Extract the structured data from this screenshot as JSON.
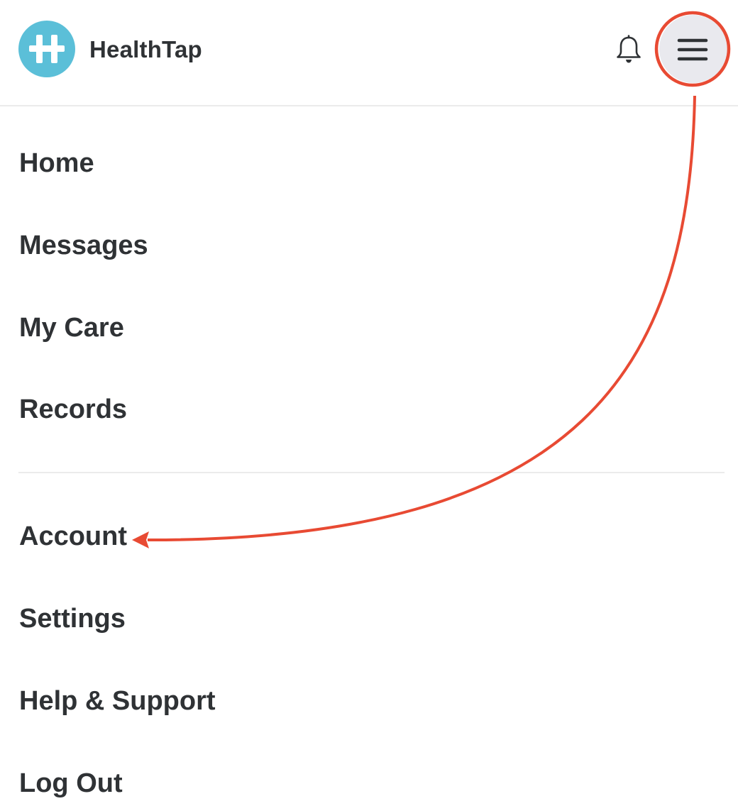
{
  "header": {
    "brand_name": "HealthTap",
    "logo_icon": "healthtap-logo-icon",
    "notifications_icon": "bell-icon",
    "menu_icon": "hamburger-menu-icon"
  },
  "menu": {
    "primary_items": [
      {
        "label": "Home"
      },
      {
        "label": "Messages"
      },
      {
        "label": "My Care"
      },
      {
        "label": "Records"
      }
    ],
    "secondary_items": [
      {
        "label": "Account"
      },
      {
        "label": "Settings"
      },
      {
        "label": "Help & Support"
      },
      {
        "label": "Log Out"
      }
    ]
  },
  "annotation": {
    "highlight_color": "#e84a33",
    "type": "arrow from menu button to Account item"
  },
  "colors": {
    "brand_teal": "#5bbfd8",
    "text": "#2f3235",
    "menu_button_bg": "#e9e9ee",
    "divider": "#ebebeb"
  }
}
